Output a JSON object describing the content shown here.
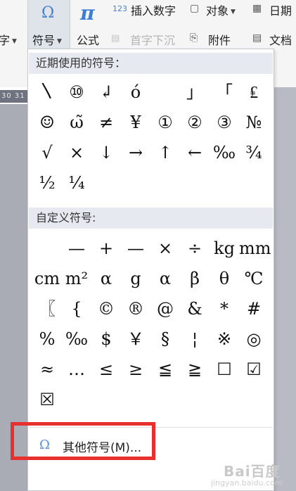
{
  "ribbon": {
    "left_cut_label": "字",
    "symbol_label": "符号",
    "formula_label": "公式",
    "insert_number_label": "插入数字",
    "object_label": "对象",
    "date_label": "日期",
    "first_drop_label": "首字下沉",
    "attachment_label": "附件",
    "doc_label": "文档",
    "ruler_text": "30 31"
  },
  "menu": {
    "recent_header": "近期使用的符号：",
    "recent_symbols": [
      "〵",
      "⑩",
      "↲",
      "ó",
      "",
      "」",
      "「",
      "₤",
      "☺",
      "ω̃",
      "≠",
      "¥",
      "①",
      "②",
      "③",
      "№",
      "√",
      "×",
      "↓",
      "→",
      "↑",
      "←",
      "‰",
      "¾",
      "½",
      "¼"
    ],
    "custom_header": "自定义符号:",
    "custom_symbols": [
      "",
      "—",
      "+",
      "—",
      "×",
      "÷",
      "kg",
      "mm",
      "cm",
      "m²",
      "α",
      "g",
      "α",
      "β",
      "θ",
      "℃",
      "〖",
      "{",
      "©",
      "®",
      "@",
      "&",
      "*",
      "#",
      "%",
      "‰",
      "$",
      "￥",
      "§",
      "¦",
      "※",
      "◎",
      "≈",
      "…",
      "≤",
      "≥",
      "≦",
      "≧",
      "☐",
      "☑",
      "☒"
    ],
    "more_icon": "Ω",
    "more_label": "其他符号(M)..."
  },
  "watermark": {
    "brand": "Bai百度",
    "sub": "jingyan.baidu.com"
  },
  "colors": {
    "accent": "#4a7fd0",
    "highlight_box": "#e8302e",
    "section_header_bg": "#e6e9f0"
  }
}
